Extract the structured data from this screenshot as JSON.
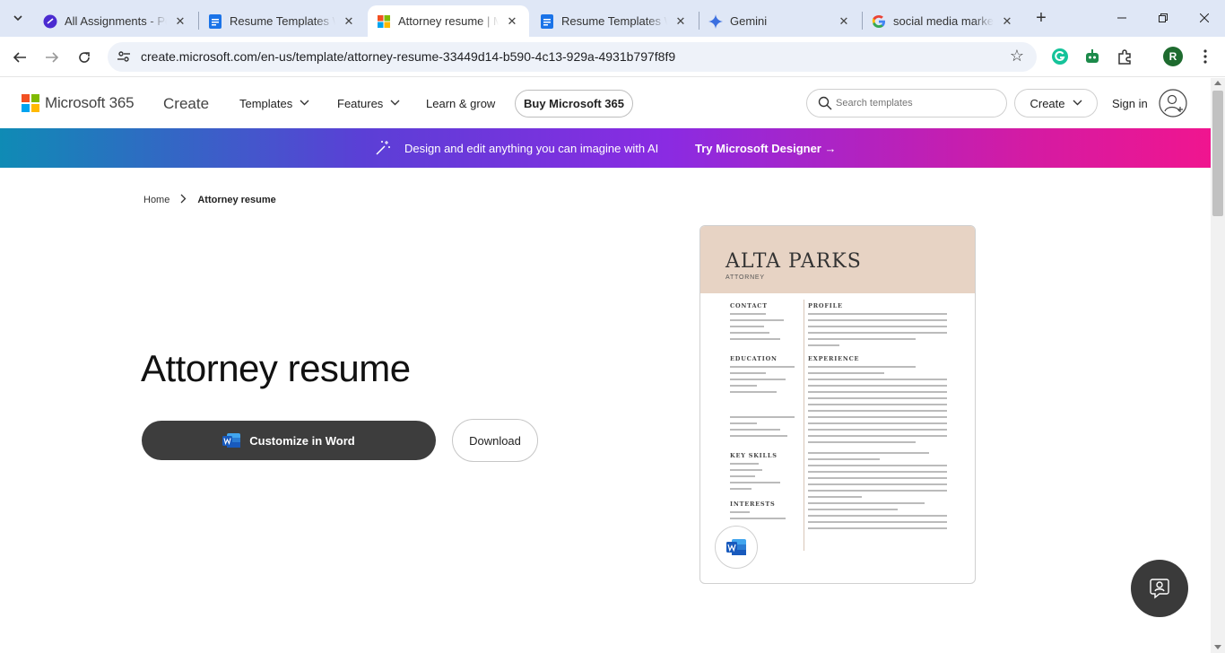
{
  "browser": {
    "tabs": [
      {
        "title": "All Assignments - Pep",
        "icon": "pep-icon"
      },
      {
        "title": "Resume Templates W",
        "icon": "docs-icon"
      },
      {
        "title": "Attorney resume | Mi",
        "icon": "microsoft-icon",
        "active": true
      },
      {
        "title": "Resume Templates W",
        "icon": "docs-icon"
      },
      {
        "title": "Gemini",
        "icon": "gemini-icon"
      },
      {
        "title": "social media marketi",
        "icon": "google-icon"
      }
    ],
    "url": "create.microsoft.com/en-us/template/attorney-resume-33449d14-b590-4c13-929a-4931b797f8f9",
    "profile_initial": "R"
  },
  "header": {
    "brand": "Microsoft 365",
    "create": "Create",
    "nav": {
      "templates": "Templates",
      "features": "Features",
      "learn": "Learn & grow"
    },
    "buy": "Buy Microsoft 365",
    "search_placeholder": "Search templates",
    "create_button": "Create",
    "sign_in": "Sign in"
  },
  "banner": {
    "message": "Design and edit anything you can imagine with AI",
    "cta": "Try Microsoft Designer →"
  },
  "breadcrumb": {
    "home": "Home",
    "current": "Attorney resume"
  },
  "main": {
    "title": "Attorney resume",
    "customize_label": "Customize in Word",
    "download_label": "Download"
  },
  "preview": {
    "name": "ALTA PARKS",
    "role": "ATTORNEY",
    "sections": {
      "contact": "CONTACT",
      "profile": "PROFILE",
      "education": "EDUCATION",
      "experience": "EXPERIENCE",
      "key_skills": "KEY SKILLS",
      "interests": "INTERESTS"
    }
  },
  "colors": {
    "banner_start": "#0f8bb5",
    "banner_end": "#f0158f",
    "primary_button": "#3d3d3d",
    "resume_header": "#e7d3c4"
  }
}
